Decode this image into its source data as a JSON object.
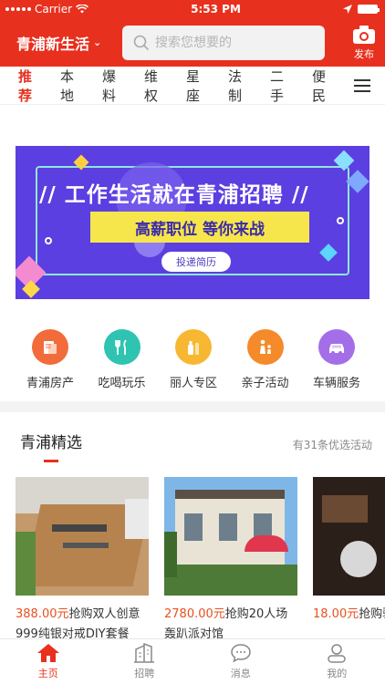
{
  "status": {
    "carrier": "Carrier",
    "time": "5:53 PM"
  },
  "header": {
    "city": "青浦新生活",
    "search_placeholder": "搜索您想要的",
    "publish_label": "发布"
  },
  "tabs": [
    "推荐",
    "本地",
    "爆料",
    "维权",
    "星座",
    "法制",
    "二手",
    "便民"
  ],
  "banner": {
    "headline": "// 工作生活就在青浦招聘 //",
    "slogan": "高薪职位  等你来战",
    "cta": "投递简历"
  },
  "services": [
    {
      "label": "青浦房产",
      "icon": "house-doc-icon",
      "color": "#f26b3a"
    },
    {
      "label": "吃喝玩乐",
      "icon": "fork-knife-icon",
      "color": "#2fc3b1"
    },
    {
      "label": "丽人专区",
      "icon": "cosmetics-icon",
      "color": "#f7b733"
    },
    {
      "label": "亲子活动",
      "icon": "parent-child-icon",
      "color": "#f58a2a"
    },
    {
      "label": "车辆服务",
      "icon": "car-icon",
      "color": "#a46ee8"
    }
  ],
  "section": {
    "title": "青浦精选",
    "subtitle": "有31条优选活动"
  },
  "cards": [
    {
      "price": "388.00元",
      "text": "抢购双人创意999纯银对戒DIY套餐"
    },
    {
      "price": "2780.00元",
      "text": "抢购20人场轰趴派对馆"
    },
    {
      "price": "18.00元",
      "text": "抢购验卡"
    }
  ],
  "bottom_nav": [
    "主页",
    "招聘",
    "消息",
    "我的"
  ],
  "colors": {
    "brand": "#e8301e",
    "banner": "#5b3fe0",
    "price": "#e8501e"
  }
}
